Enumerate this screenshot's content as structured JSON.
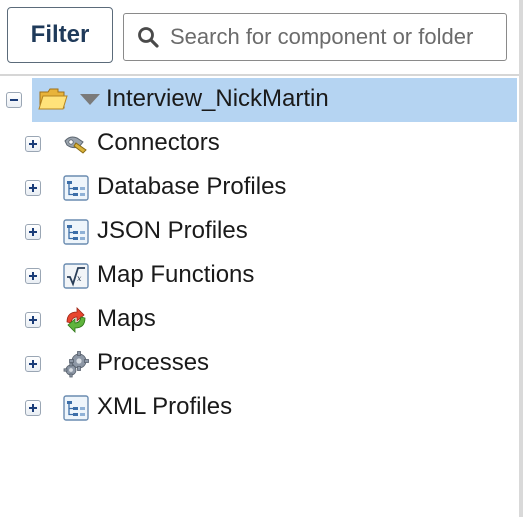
{
  "toolbar": {
    "filter_label": "Filter",
    "search_placeholder": "Search for component or folder",
    "search_value": ""
  },
  "tree": {
    "root": {
      "label": "Interview_NickMartin",
      "icon": "folder-icon",
      "expanded": true,
      "selected": true
    },
    "items": [
      {
        "label": "Connectors",
        "icon": "connector-icon"
      },
      {
        "label": "Database Profiles",
        "icon": "profile-icon"
      },
      {
        "label": "JSON Profiles",
        "icon": "profile-icon"
      },
      {
        "label": "Map Functions",
        "icon": "function-icon"
      },
      {
        "label": "Maps",
        "icon": "map-icon"
      },
      {
        "label": "Processes",
        "icon": "gears-icon"
      },
      {
        "label": "XML Profiles",
        "icon": "profile-icon"
      }
    ]
  },
  "colors": {
    "selection_bg": "#b5d4f2",
    "filter_text": "#1f3a5a",
    "expander_sign": "#1a3c78"
  }
}
